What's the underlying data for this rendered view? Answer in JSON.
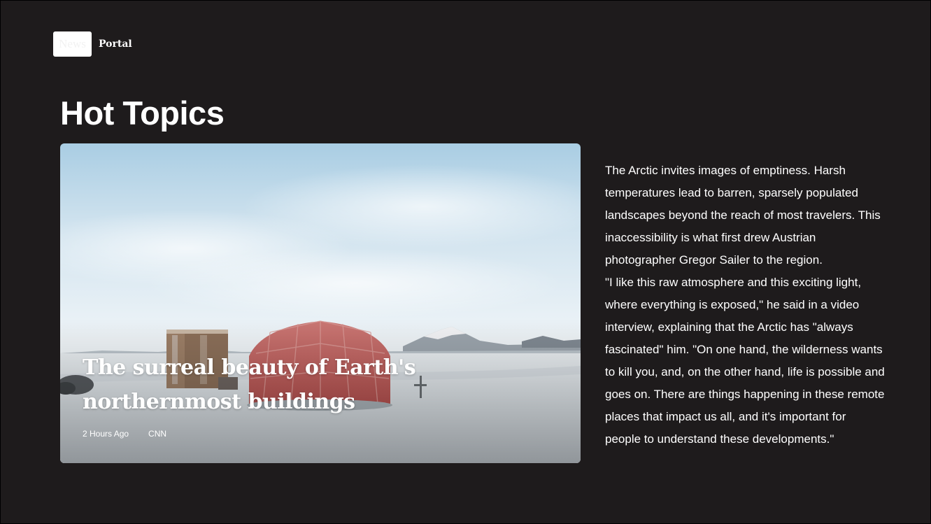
{
  "brand": {
    "logo_text": "News",
    "name": "Portal"
  },
  "section": {
    "title": "Hot Topics"
  },
  "featured": {
    "title": "The surreal beauty of Earth's northernmost buildings",
    "time": "2 Hours Ago",
    "source": "CNN"
  },
  "article": {
    "paragraphs": [
      "The Arctic invites images of emptiness. Harsh temperatures lead to barren, sparsely populated landscapes beyond the reach of most travelers. This inaccessibility is what first drew Austrian photographer Gregor Sailer to the region.",
      "\"I like this raw atmosphere and this exciting light, where everything is exposed,\" he said in a video interview, explaining that the Arctic has \"always fascinated\" him. \"On one hand, the wilderness wants to kill you, and, on the other hand, life is possible and goes on. There are things happening in these remote places that impact us all, and it's important for people to understand these developments.\""
    ]
  },
  "colors": {
    "background": "#1e1b1c",
    "text": "#ffffff"
  }
}
